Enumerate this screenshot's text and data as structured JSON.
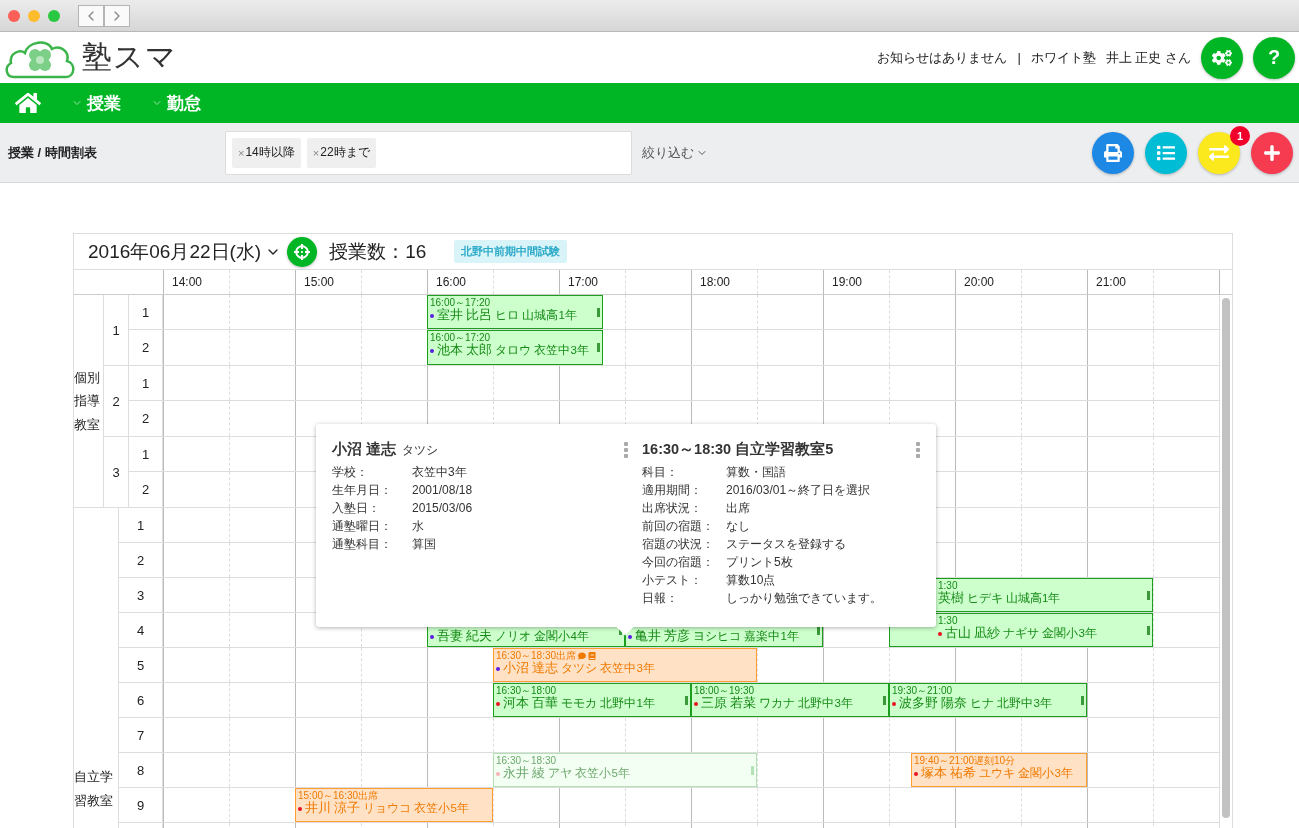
{
  "header": {
    "logo_text": "塾スマ",
    "notice": "お知らせはありません",
    "separator": "|",
    "school": "ホワイト塾",
    "user": "井上 正史 さん",
    "help_label": "?"
  },
  "nav": {
    "items": [
      {
        "label": "授業"
      },
      {
        "label": "勤怠"
      }
    ]
  },
  "toolbar": {
    "breadcrumb": "授業 / 時間割表",
    "filters": [
      {
        "remove": "×",
        "label": "14時以降"
      },
      {
        "remove": "×",
        "label": "22時まで"
      }
    ],
    "filter_button": "絞り込む",
    "badge": "1"
  },
  "calendar": {
    "date": "2016年06月22日(水)",
    "lesson_count": "授業数：16",
    "event_tag": "北野中前期中間試験",
    "hours": [
      "14:00",
      "15:00",
      "16:00",
      "17:00",
      "18:00",
      "19:00",
      "20:00",
      "21:00"
    ],
    "groups": [
      {
        "label": "個別指導教室",
        "subgroups": [
          {
            "label": "1",
            "rows": [
              {
                "label": "1",
                "events": [
                  {
                    "kind": "lesson",
                    "faded": false,
                    "time": "16:00～17:20",
                    "name": "室井 比呂",
                    "reading": "ヒロ",
                    "school": "山城高1年",
                    "color": "#5a1ee6"
                  }
                ]
              },
              {
                "label": "2",
                "events": [
                  {
                    "kind": "lesson",
                    "faded": false,
                    "time": "16:00～17:20",
                    "name": "池本 太郎",
                    "reading": "タロウ",
                    "school": "衣笠中3年",
                    "color": "#5a1ee6"
                  }
                ]
              }
            ]
          },
          {
            "label": "2",
            "rows": [
              {
                "label": "1",
                "events": []
              },
              {
                "label": "2",
                "events": []
              }
            ]
          },
          {
            "label": "3",
            "rows": [
              {
                "label": "1",
                "events": []
              },
              {
                "label": "2",
                "events": []
              }
            ]
          }
        ]
      },
      {
        "label": "自立学習教室",
        "rows": [
          {
            "label": "1",
            "events": []
          },
          {
            "label": "2",
            "events": []
          },
          {
            "label": "3",
            "events": [
              {
                "kind": "lesson",
                "faded": false,
                "time": "1:30",
                "name": "英樹",
                "reading": "ヒデキ",
                "school": "山城高1年"
              }
            ]
          },
          {
            "label": "4",
            "events": [
              {
                "kind": "lesson",
                "faded": false,
                "name": "吾妻 紀夫",
                "reading": "ノリオ",
                "school": "金閣小4年",
                "color": "#5a1ee6"
              },
              {
                "kind": "lesson",
                "faded": false,
                "name": "亀井 芳彦",
                "reading": "ヨシヒコ",
                "school": "嘉楽中1年",
                "color": "#5a1ee6"
              },
              {
                "kind": "lesson",
                "faded": false,
                "time": "1:30",
                "name": "古山 凪紗",
                "reading": "ナギサ",
                "school": "金閣小3年",
                "color": "#e8141e"
              }
            ]
          },
          {
            "label": "5",
            "events": [
              {
                "kind": "attendance",
                "faded": false,
                "time": "16:30～18:30出席",
                "comment": true,
                "note": true,
                "name": "小沼 達志",
                "reading": "タツシ",
                "school": "衣笠中3年",
                "color": "#5a1ee6"
              }
            ]
          },
          {
            "label": "6",
            "events": [
              {
                "kind": "lesson",
                "faded": false,
                "time": "16:30～18:00",
                "name": "河本 百華",
                "reading": "モモカ",
                "school": "北野中1年",
                "color": "#e8141e"
              },
              {
                "kind": "lesson",
                "faded": false,
                "time": "18:00～19:30",
                "name": "三原 若菜",
                "reading": "ワカナ",
                "school": "北野中3年",
                "color": "#e8141e"
              },
              {
                "kind": "lesson",
                "faded": false,
                "time": "19:30～21:00",
                "name": "波多野 陽奈",
                "reading": "ヒナ",
                "school": "北野中3年",
                "color": "#e8141e"
              }
            ]
          },
          {
            "label": "7",
            "events": []
          },
          {
            "label": "8",
            "events": [
              {
                "kind": "lesson",
                "faded": true,
                "time": "16:30～18:30",
                "name": "永井 綾",
                "reading": "アヤ",
                "school": "衣笠小5年",
                "color": "#f6b3b8"
              },
              {
                "kind": "attendance",
                "faded": false,
                "time": "19:40～21:00遅刻10分",
                "name": "塚本 祐希",
                "reading": "ユウキ",
                "school": "金閣小3年",
                "color": "#e8141e"
              }
            ]
          },
          {
            "label": "9",
            "events": [
              {
                "kind": "attendance",
                "faded": false,
                "time": "15:00～16:30出席",
                "name": "井川 涼子",
                "reading": "リョウコ",
                "school": "衣笠小5年",
                "color": "#e8141e"
              }
            ]
          },
          {
            "label": "",
            "events": []
          }
        ]
      }
    ]
  },
  "popup": {
    "student": {
      "name": "小沼 達志",
      "reading": "タツシ",
      "fields": [
        {
          "label": "学校：",
          "value": "衣笠中3年"
        },
        {
          "label": "生年月日：",
          "value": "2001/08/18"
        },
        {
          "label": "入塾日：",
          "value": "2015/03/06"
        },
        {
          "label": "通塾曜日：",
          "value": "水"
        },
        {
          "label": "通塾科目：",
          "value": "算国"
        }
      ]
    },
    "lesson": {
      "title": "16:30～18:30 自立学習教室5",
      "fields": [
        {
          "label": "科目：",
          "value": "算数・国語"
        },
        {
          "label": "適用期間：",
          "value": "2016/03/01～終了日を選択"
        },
        {
          "label": "出席状況：",
          "value": "出席"
        },
        {
          "label": "前回の宿題：",
          "value": "なし"
        },
        {
          "label": "宿題の状況：",
          "value": "ステータスを登録する"
        },
        {
          "label": "今回の宿題：",
          "value": "プリント5枚"
        },
        {
          "label": "小テスト：",
          "value": "算数10点"
        },
        {
          "label": "日報：",
          "value": "しっかり勉強できています。"
        }
      ]
    }
  }
}
